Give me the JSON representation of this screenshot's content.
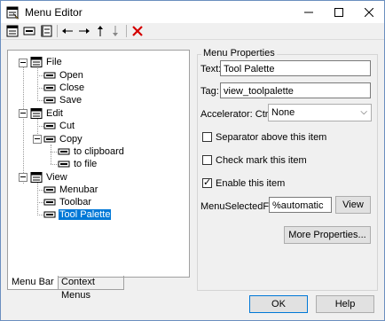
{
  "window": {
    "title": "Menu Editor"
  },
  "toolbar": {
    "icons": [
      "menu-bar-icon",
      "new-menu-item-icon",
      "context-menu-icon",
      "move-left-icon",
      "move-right-icon",
      "move-up-icon",
      "move-down-icon",
      "delete-icon"
    ]
  },
  "tree": {
    "nodes": [
      {
        "label": "File"
      },
      {
        "label": "Open"
      },
      {
        "label": "Close"
      },
      {
        "label": "Save"
      },
      {
        "label": "Edit"
      },
      {
        "label": "Cut"
      },
      {
        "label": "Copy"
      },
      {
        "label": "to clipboard"
      },
      {
        "label": "to file"
      },
      {
        "label": "View"
      },
      {
        "label": "Menubar"
      },
      {
        "label": "Toolbar"
      },
      {
        "label": "Tool Palette"
      }
    ]
  },
  "tabs": [
    "Menu Bar",
    "Context Menus"
  ],
  "props": {
    "legend": "Menu Properties",
    "text_label": "Text:",
    "text_value": "Tool Palette",
    "tag_label": "Tag:",
    "tag_value": "view_toolpalette",
    "accelerator_label": "Accelerator: Ctrl +",
    "accelerator_value": "None",
    "separator_label": "Separator above this item",
    "separator_checked": false,
    "checkmark_label": "Check mark this item",
    "checkmark_checked": false,
    "enable_label": "Enable this item",
    "enable_checked": true,
    "fcn_label": "MenuSelectedFcn:",
    "fcn_value": "%automatic",
    "view_button": "View",
    "more_button": "More Properties..."
  },
  "footer": {
    "ok": "OK",
    "help": "Help"
  },
  "colors": {
    "selection": "#0078d7",
    "delete": "#d40000"
  }
}
